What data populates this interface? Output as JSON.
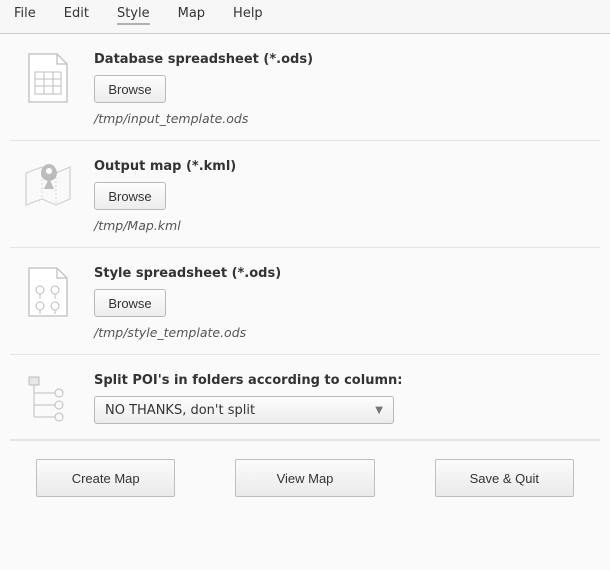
{
  "menu": {
    "items": [
      "File",
      "Edit",
      "Style",
      "Map",
      "Help"
    ]
  },
  "rows": {
    "db": {
      "title": "Database spreadsheet (*.ods)",
      "browse": "Browse",
      "path": "/tmp/input_template.ods"
    },
    "out": {
      "title": "Output map (*.kml)",
      "browse": "Browse",
      "path": "/tmp/Map.kml"
    },
    "style": {
      "title": "Style spreadsheet (*.ods)",
      "browse": "Browse",
      "path": "/tmp/style_template.ods"
    },
    "split": {
      "title": "Split POI's in folders according to column:",
      "value": "NO THANKS, don't split"
    }
  },
  "footer": {
    "create": "Create Map",
    "view": "View Map",
    "save": "Save & Quit"
  }
}
